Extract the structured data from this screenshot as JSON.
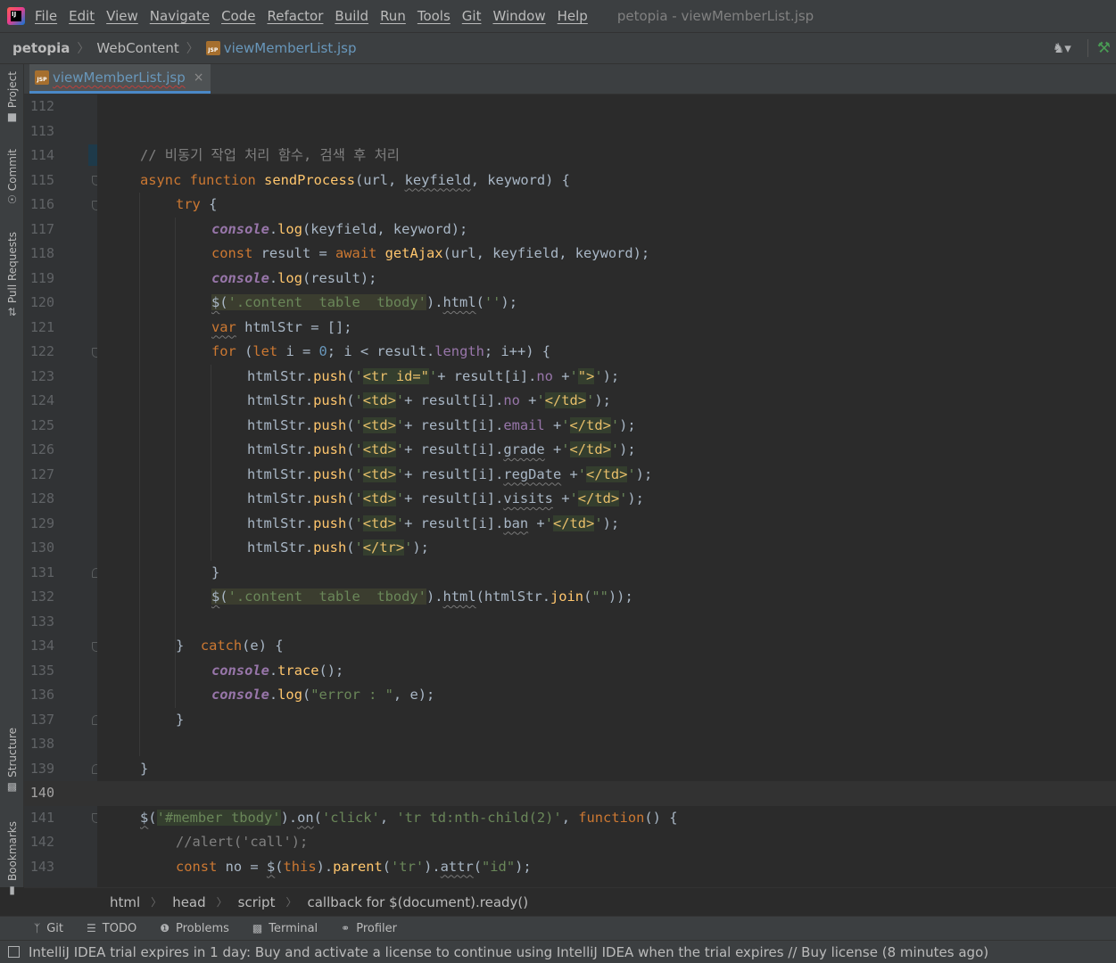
{
  "menubar": {
    "items": [
      "File",
      "Edit",
      "View",
      "Navigate",
      "Code",
      "Refactor",
      "Build",
      "Run",
      "Tools",
      "Git",
      "Window",
      "Help"
    ],
    "window_title": "petopia - viewMemberList.jsp"
  },
  "navbar": {
    "project": "petopia",
    "folder": "WebContent",
    "file": "viewMemberList.jsp",
    "file_icon_text": "JSP"
  },
  "left_tool_tabs": {
    "project": "Project",
    "commit": "Commit",
    "pull_requests": "Pull Requests",
    "structure": "Structure",
    "bookmarks": "Bookmarks"
  },
  "editor_tab": {
    "label": "viewMemberList.jsp",
    "icon_text": "JSP",
    "close": "×"
  },
  "gutter": {
    "line_numbers": [
      "112",
      "113",
      "114",
      "115",
      "116",
      "117",
      "118",
      "119",
      "120",
      "121",
      "122",
      "123",
      "124",
      "125",
      "126",
      "127",
      "128",
      "129",
      "130",
      "131",
      "132",
      "133",
      "134",
      "135",
      "136",
      "137",
      "138",
      "139",
      "140",
      "141",
      "142",
      "143"
    ],
    "current_line": "140"
  },
  "code": {
    "l114": "// 비동기 작업 처리 함수, 검색 후 처리",
    "l115": {
      "async": "async",
      "function": "function",
      "name": "sendProcess",
      "p1": "(url, ",
      "p2": "keyfield",
      "p3": ", keyword) {"
    },
    "l116": {
      "try": "try",
      "brace": " {"
    },
    "l117": {
      "console": "console",
      "rest1": ".",
      "method": "log",
      "rest2": "(keyfield, keyword);"
    },
    "l118": {
      "const": "const",
      "mid": " result = ",
      "await": "await",
      "sp": " ",
      "fn": "getAjax",
      "args": "(url, keyfield, keyword);"
    },
    "l119": {
      "console": "console",
      "rest1": ".",
      "method": "log",
      "rest2": "(result);"
    },
    "l120": {
      "dollar": "$",
      "open": "(",
      "sel": "'.content  table  tbody'",
      "close": ")",
      "dot": ".",
      "html": "html",
      "args_open": "(",
      "str": "''",
      "args_close": ");"
    },
    "l121": {
      "var": "var",
      "rest": " htmlStr = [];"
    },
    "l122": {
      "for": "for",
      "p1": " (",
      "let": "let",
      "p2": " i = ",
      "zero": "0",
      "p3": "; i < result.",
      "length": "length",
      "p4": "; i++) {"
    },
    "push_prefix": "htmlStr.",
    "push": "push",
    "l123": {
      "q1": "'",
      "tag": "<tr id=\"",
      "q2": "'",
      "mid": "+ result[i].",
      "prop": "no",
      "plus": " +",
      "q3": "'",
      "tag2": "\">",
      "q4": "'",
      "end": ");"
    },
    "l124": {
      "tag": "<td>",
      "prop": "no",
      "tag2": "</td>"
    },
    "l125": {
      "tag": "<td>",
      "prop": "email",
      "tag2": "</td>"
    },
    "l126": {
      "tag": "<td>",
      "prop": "grade",
      "tag2": "</td>"
    },
    "l127": {
      "tag": "<td>",
      "prop": "regDate",
      "tag2": "</td>"
    },
    "l128": {
      "tag": "<td>",
      "prop": "visits",
      "tag2": "</td>"
    },
    "l129": {
      "tag": "<td>",
      "prop": "ban",
      "tag2": "</td>"
    },
    "l130": {
      "tag": "</tr>"
    },
    "l131": "}",
    "l132": {
      "dollar": "$",
      "open": "(",
      "sel": "'.content  table  tbody'",
      "close": ")",
      "dot": ".",
      "html": "html",
      "rest1": "(htmlStr.",
      "join": "join",
      "rest2": "(",
      "str": "\"\"",
      "rest3": "));"
    },
    "l134": {
      "brace": "}  ",
      "catch": "catch",
      "rest": "(e) {"
    },
    "l135": {
      "console": "console",
      "dot": ".",
      "method": "trace",
      "rest": "();"
    },
    "l136": {
      "console": "console",
      "dot": ".",
      "method": "log",
      "p1": "(",
      "str": "\"error : \"",
      "p2": ", e);"
    },
    "l137": "}",
    "l139": "}",
    "l141": {
      "dollar": "$",
      "open": "(",
      "sel": "'#member tbody'",
      "close": ")",
      "dot": ".",
      "on": "on",
      "p1": "(",
      "s1": "'click'",
      "c1": ", ",
      "s2": "'tr td:nth-child(2)'",
      "c2": ", ",
      "function": "function",
      "p2": "() {"
    },
    "l142": "//alert('call');",
    "l143": {
      "const": "const",
      "mid": " no = ",
      "dollar": "$",
      "p1": "(",
      "this": "this",
      "p2": ").",
      "parent": "parent",
      "p3": "(",
      "s1": "'tr'",
      "p4": ").",
      "attr": "attr",
      "p5": "(",
      "s2": "\"id\"",
      "p6": ");"
    },
    "sep": ", ",
    "sc": ";",
    "plus_q": "+ result[i].",
    "plus_end": " +"
  },
  "breadcrumbs": [
    "html",
    "head",
    "script",
    "callback for $(document).ready()"
  ],
  "tool_windows": [
    {
      "icon": "git-branch-icon",
      "label": "Git"
    },
    {
      "icon": "list-icon",
      "label": "TODO"
    },
    {
      "icon": "problems-icon",
      "label": "Problems"
    },
    {
      "icon": "terminal-icon",
      "label": "Terminal"
    },
    {
      "icon": "profiler-icon",
      "label": "Profiler"
    }
  ],
  "status": {
    "message": "IntelliJ IDEA trial expires in 1 day: Buy and activate a license to continue using IntelliJ IDEA when the trial expires // Buy license (8 minutes ago)"
  }
}
